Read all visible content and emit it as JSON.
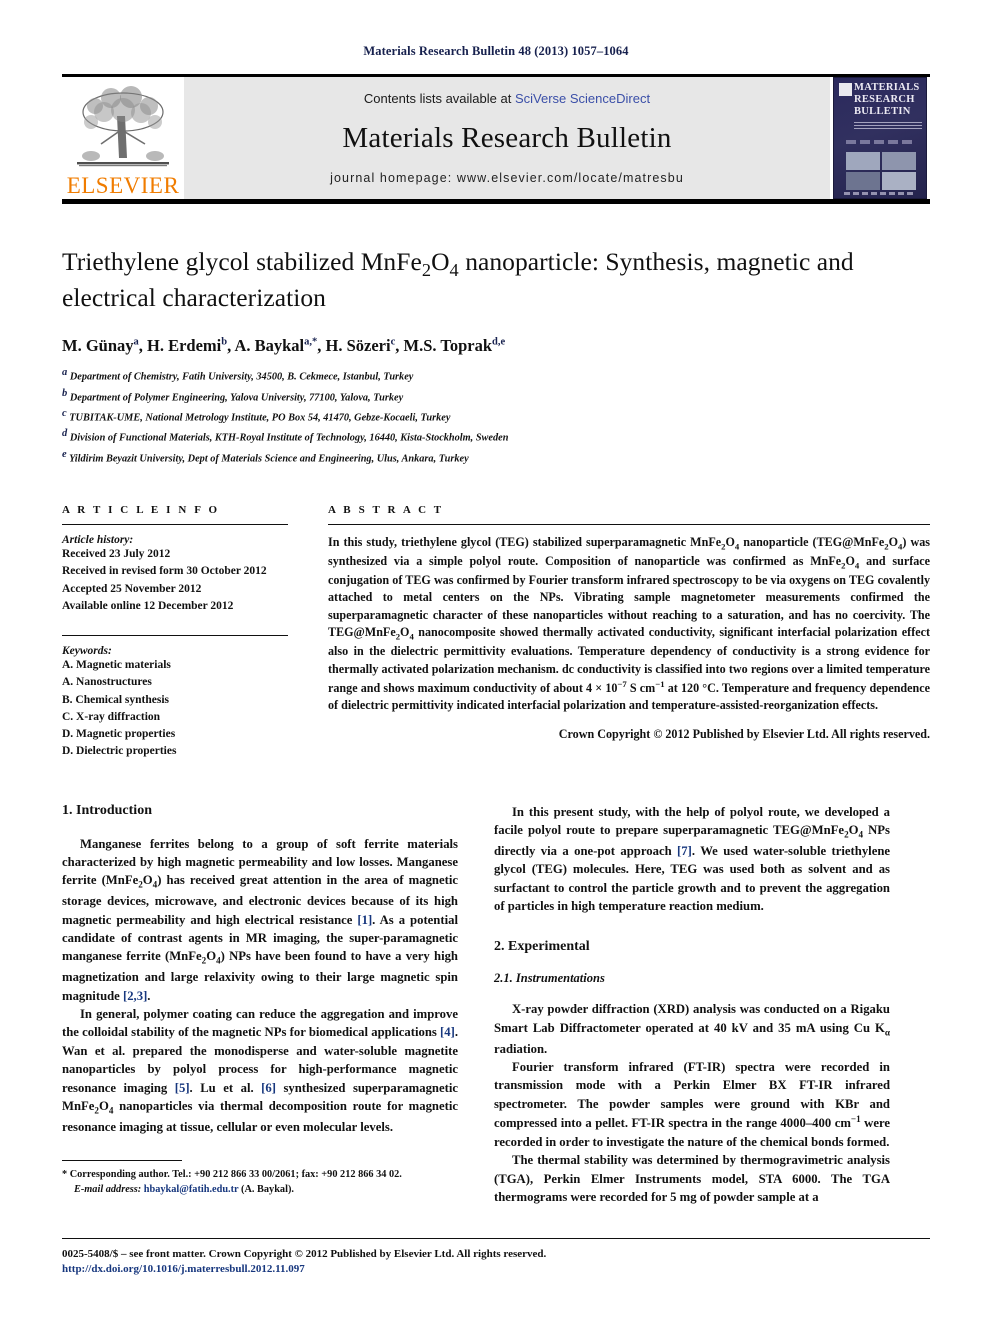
{
  "running_head": "Materials Research Bulletin 48 (2013) 1057–1064",
  "header": {
    "contents_prefix": "Contents lists available at ",
    "contents_link": "SciVerse ScienceDirect",
    "journal_name": "Materials Research Bulletin",
    "homepage": "journal homepage: www.elsevier.com/locate/matresbu",
    "publisher_logo_text": "ELSEVIER",
    "cover_title": "MATERIALS RESEARCH BULLETIN"
  },
  "article": {
    "title": "Triethylene glycol stabilized MnFe2O4 nanoparticle: Synthesis, magnetic and electrical characterization",
    "authors_html": "M. Günay <sup>a</sup>, H. Erdemi <sup>b</sup>, A. Baykal <sup>a,*</sup>, H. Sözeri <sup>c</sup>, M.S. Toprak <sup>d,e</sup>",
    "affiliations": [
      {
        "marker": "a",
        "text": "Department of Chemistry, Fatih University, 34500, B. Cekmece, Istanbul, Turkey"
      },
      {
        "marker": "b",
        "text": "Department of Polymer Engineering, Yalova University, 77100, Yalova, Turkey"
      },
      {
        "marker": "c",
        "text": "TUBITAK-UME, National Metrology Institute, PO Box 54, 41470, Gebze-Kocaeli, Turkey"
      },
      {
        "marker": "d",
        "text": "Division of Functional Materials, KTH-Royal Institute of Technology, 16440, Kista-Stockholm, Sweden"
      },
      {
        "marker": "e",
        "text": "Yildirim Beyazit University, Dept of Materials Science and Engineering, Ulus, Ankara, Turkey"
      }
    ]
  },
  "article_info": {
    "label": "A R T I C L E   I N F O",
    "history_label": "Article history:",
    "history": [
      "Received 23 July 2012",
      "Received in revised form 30 October 2012",
      "Accepted 25 November 2012",
      "Available online 12 December 2012"
    ],
    "keywords_label": "Keywords:",
    "keywords": [
      "A. Magnetic materials",
      "A. Nanostructures",
      "B. Chemical synthesis",
      "C. X-ray diffraction",
      "D. Magnetic properties",
      "D. Dielectric properties"
    ]
  },
  "abstract": {
    "label": "A B S T R A C T",
    "copyright": "Crown Copyright © 2012 Published by Elsevier Ltd. All rights reserved."
  },
  "body": {
    "intro_heading": "1. Introduction",
    "experimental_heading": "2. Experimental",
    "instrumentations_heading": "2.1. Instrumentations"
  },
  "footnote": {
    "corresponding": "* Corresponding author. Tel.: +90 212 866 33 00/2061; fax: +90 212 866 34 02.",
    "email_label": "E-mail address:",
    "email": "hbaykal@fatih.edu.tr",
    "email_suffix": "(A. Baykal)."
  },
  "bottom": {
    "issn_line": "0025-5408/$ – see front matter. Crown Copyright © 2012 Published by Elsevier Ltd. All rights reserved.",
    "doi": "http://dx.doi.org/10.1016/j.materresbull.2012.11.097"
  },
  "colors": {
    "link": "#17377e",
    "running_head": "#17214e",
    "elsevier_orange": "#f07c00",
    "header_grey": "#e7e7e7"
  }
}
